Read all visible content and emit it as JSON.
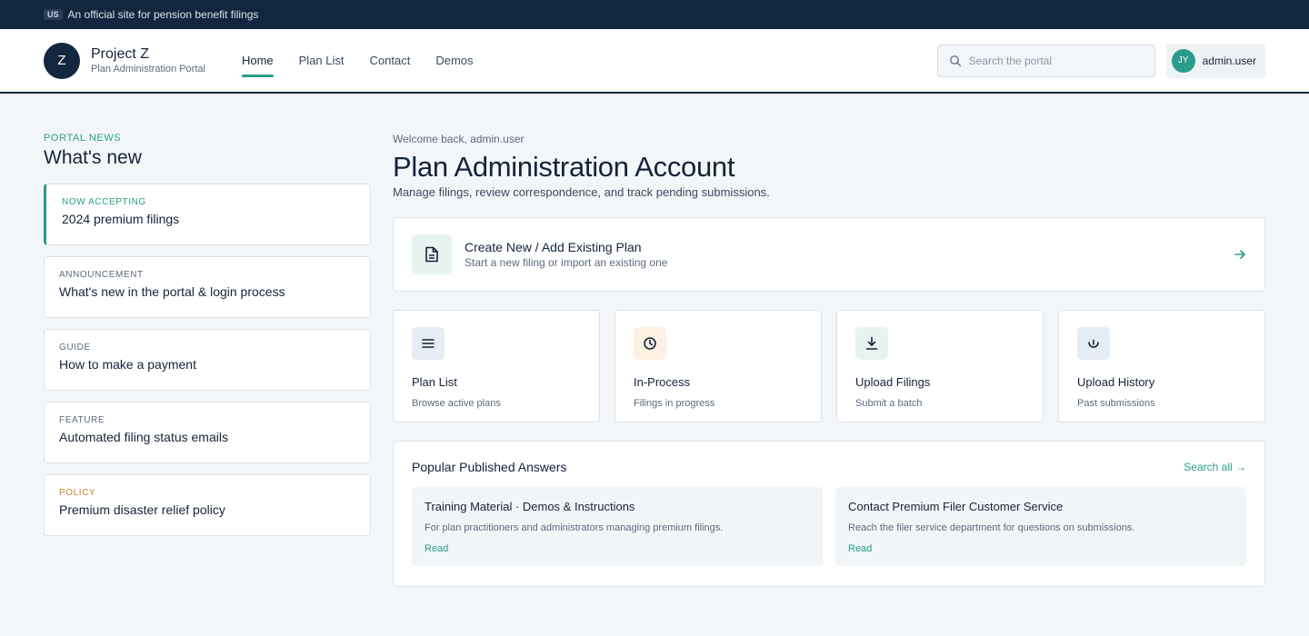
{
  "gov_banner": {
    "flag": "US",
    "text": "An official site for pension benefit filings"
  },
  "header": {
    "logo_letter": "Z",
    "brand_name": "Project Z",
    "brand_sub": "Plan Administration Portal",
    "nav": [
      {
        "label": "Home",
        "active": true
      },
      {
        "label": "Plan List",
        "active": false
      },
      {
        "label": "Contact",
        "active": false
      },
      {
        "label": "Demos",
        "active": false
      }
    ],
    "search_placeholder": "Search the portal",
    "user": {
      "initials": "JY",
      "name": "admin.user"
    }
  },
  "sidebar": {
    "eyebrow": "PORTAL NEWS",
    "title": "What's new",
    "news": [
      {
        "tag": "NOW ACCEPTING",
        "text": "2024 premium filings"
      },
      {
        "tag": "ANNOUNCEMENT",
        "text": "What's new in the portal & login process"
      },
      {
        "tag": "GUIDE",
        "text": "How to make a payment"
      },
      {
        "tag": "FEATURE",
        "text": "Automated filing status emails"
      },
      {
        "tag": "POLICY",
        "text": "Premium disaster relief policy"
      }
    ]
  },
  "content": {
    "welcome": "Welcome back, admin.user",
    "title": "Plan Administration Account",
    "description": "Manage filings, review correspondence, and track pending submissions.",
    "create": {
      "title": "Create New / Add Existing Plan",
      "sub": "Start a new filing or import an existing one"
    },
    "tiles": [
      {
        "title": "Plan List",
        "sub": "Browse active plans",
        "icon": "list-icon",
        "bg": "#e6ecf3"
      },
      {
        "title": "In-Process",
        "sub": "Filings in progress",
        "icon": "clock-icon",
        "bg": "#fdf1e2"
      },
      {
        "title": "Upload Filings",
        "sub": "Submit a batch",
        "icon": "download-icon",
        "bg": "#e7f3f1"
      },
      {
        "title": "Upload History",
        "sub": "Past submissions",
        "icon": "history-icon",
        "bg": "#e6ecf3"
      }
    ],
    "answers": {
      "title": "Popular Published Answers",
      "search_all": "Search all →",
      "items": [
        {
          "title": "Training Material · Demos & Instructions",
          "desc": "For plan practitioners and administrators managing premium filings.",
          "link": "Read"
        },
        {
          "title": "Contact Premium Filer Customer Service",
          "desc": "Reach the filer service department for questions on submissions.",
          "link": "Read"
        }
      ]
    }
  },
  "colors": {
    "navy": "#13263f",
    "accent": "#2a9d8a",
    "policy": "#c4862a",
    "background": "#f3f6f9"
  }
}
